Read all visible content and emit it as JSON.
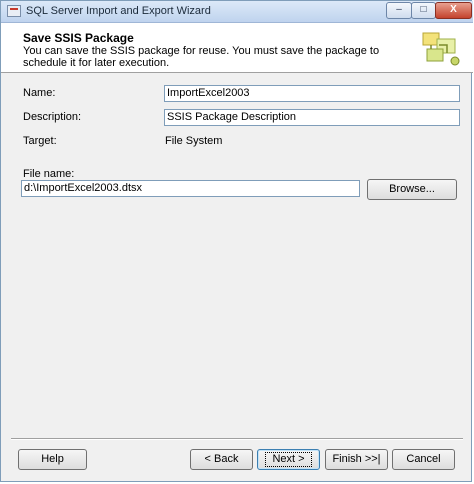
{
  "window": {
    "title": "SQL Server Import and Export Wizard"
  },
  "titlebar_buttons": {
    "minimize": "–",
    "maximize": "□",
    "close": "X"
  },
  "header": {
    "title": "Save SSIS Package",
    "description": "You can save the SSIS package for reuse. You must save the package to schedule it for later execution."
  },
  "form": {
    "name_label": "Name:",
    "name_value": "ImportExcel2003",
    "description_label": "Description:",
    "description_value": "SSIS Package Description",
    "target_label": "Target:",
    "target_value": "File System",
    "filename_label": "File name:",
    "filename_value": "d:\\ImportExcel2003.dtsx",
    "browse_label": "Browse..."
  },
  "footer": {
    "help": "Help",
    "back": "< Back",
    "next": "Next >",
    "finish": "Finish >>|",
    "cancel": "Cancel"
  }
}
